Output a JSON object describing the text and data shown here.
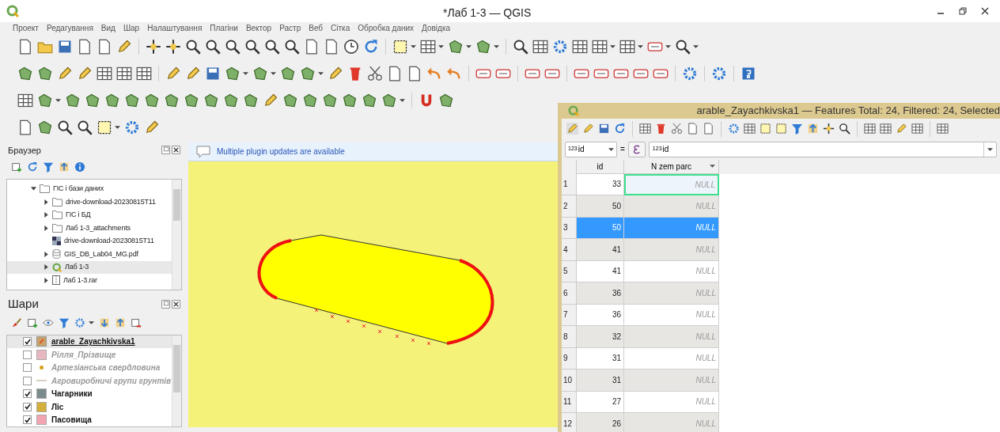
{
  "window": {
    "title": "*Лаб 1-3 — QGIS"
  },
  "menu": [
    "Проект",
    "Редагування",
    "Вид",
    "Шар",
    "Налаштування",
    "Плагіни",
    "Вектор",
    "Растр",
    "Веб",
    "Сітка",
    "Обробка даних",
    "Довідка"
  ],
  "browser": {
    "title": "Браузер",
    "items": [
      {
        "label": "ГІС і бази даних",
        "kind": "folder",
        "expanded": true,
        "selected": false,
        "children": [
          {
            "label": "drive-download-20230815T11",
            "kind": "folder",
            "expanded": false,
            "selected": false
          },
          {
            "label": "ГІС і БД",
            "kind": "folder",
            "expanded": false,
            "selected": false
          },
          {
            "label": "Лаб 1-3_attachments",
            "kind": "folder",
            "expanded": false,
            "selected": false
          },
          {
            "label": "drive-download-20230815T11",
            "kind": "raster",
            "expanded": false,
            "selected": false
          },
          {
            "label": "GIS_DB_Lab04_MG.pdf",
            "kind": "database",
            "expanded": false,
            "selected": false
          },
          {
            "label": "Лаб 1-3",
            "kind": "project",
            "expanded": false,
            "selected": true
          },
          {
            "label": "Лаб 1-3.rar",
            "kind": "archive",
            "expanded": false,
            "selected": false
          }
        ]
      }
    ]
  },
  "layers": {
    "title": "Шари",
    "items": [
      {
        "label": "arable_Zayachkivska1",
        "kind": "editing",
        "checked": true,
        "selected": true,
        "color": "#c8a36b"
      },
      {
        "label": "Рілля_Прізвище",
        "kind": "polygon",
        "checked": false,
        "selected": false,
        "color": "#e8b8c0"
      },
      {
        "label": "Артезіанська свердловина",
        "kind": "point",
        "checked": false,
        "selected": false,
        "color": "#d4a017"
      },
      {
        "label": "Агровиробничі групи грунтів",
        "kind": "line",
        "checked": false,
        "selected": false,
        "color": "#d8cfc0"
      },
      {
        "label": "Чагарники",
        "kind": "polygon",
        "checked": true,
        "selected": false,
        "color": "#7b8a8c"
      },
      {
        "label": "Ліс",
        "kind": "polygon",
        "checked": true,
        "selected": false,
        "color": "#d4b03a"
      },
      {
        "label": "Пасовища",
        "kind": "polygon",
        "checked": true,
        "selected": false,
        "color": "#f2a4b3"
      }
    ]
  },
  "message_bar": {
    "text": "Multiple plugin updates are available"
  },
  "attribute_table": {
    "title": "arable_Zayachkivska1 — Features Total: 24, Filtered: 24, Selected",
    "field": {
      "prefix": "123",
      "value": "id"
    },
    "operator": "=",
    "expression": {
      "prefix": "123",
      "value": "id"
    },
    "columns": [
      "id",
      "N zem parc"
    ],
    "rows": [
      {
        "number": "1",
        "id": "33",
        "value": "NULL",
        "selected": false,
        "current": true
      },
      {
        "number": "2",
        "id": "50",
        "value": "NULL",
        "selected": false,
        "current": false
      },
      {
        "number": "3",
        "id": "50",
        "value": "NULL",
        "selected": true,
        "current": false
      },
      {
        "number": "4",
        "id": "41",
        "value": "NULL",
        "selected": false,
        "current": false
      },
      {
        "number": "5",
        "id": "41",
        "value": "NULL",
        "selected": false,
        "current": false
      },
      {
        "number": "6",
        "id": "36",
        "value": "NULL",
        "selected": false,
        "current": false
      },
      {
        "number": "7",
        "id": "36",
        "value": "NULL",
        "selected": false,
        "current": false
      },
      {
        "number": "8",
        "id": "32",
        "value": "NULL",
        "selected": false,
        "current": false
      },
      {
        "number": "9",
        "id": "31",
        "value": "NULL",
        "selected": false,
        "current": false
      },
      {
        "number": "10",
        "id": "31",
        "value": "NULL",
        "selected": false,
        "current": false
      },
      {
        "number": "11",
        "id": "27",
        "value": "NULL",
        "selected": false,
        "current": false
      },
      {
        "number": "12",
        "id": "26",
        "value": "NULL",
        "selected": false,
        "current": false
      }
    ]
  }
}
